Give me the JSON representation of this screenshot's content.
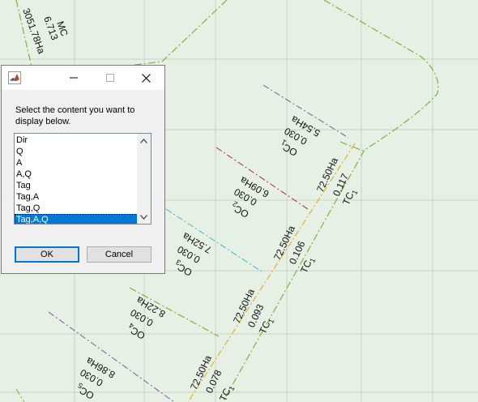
{
  "map": {
    "labels": {
      "top_area": "3051.78Ha",
      "top_dist": "6.713",
      "top_name": "MC",
      "oc1_area": "5.54Ha",
      "oc1_val": "0.030",
      "oc1_name": "OC",
      "oc1_sub": "1",
      "oc2_area": "6.09Ha",
      "oc2_val": "0.030",
      "oc2_name": "OC",
      "oc2_sub": "2",
      "oc3_area": "7.52Ha",
      "oc3_val": "0.030",
      "oc3_name": "OC",
      "oc3_sub": "3",
      "oc4_area": "8.22Ha",
      "oc4_val": "0.030",
      "oc4_name": "OC",
      "oc4_sub": "4",
      "oc5_area": "8.86Ha",
      "oc5_val": "0.030",
      "oc5_name": "OC",
      "oc5_sub": "5",
      "tc1a_area": "72.50Ha",
      "tc1a_val": "0.117",
      "tc1a_name": "TC",
      "tc1a_sub": "1",
      "tc1b_area": "72.50Ha",
      "tc1b_val": "0.106",
      "tc1b_name": "TC",
      "tc1b_sub": "1",
      "tc1c_area": "72.50Ha",
      "tc1c_val": "0.093",
      "tc1c_name": "TC",
      "tc1c_sub": "1",
      "tc1d_area": "72.50Ha",
      "tc1d_val": "0.078",
      "tc1d_name": "TC",
      "tc1d_sub": "1"
    }
  },
  "dialog": {
    "prompt": "Select the content you want to display below.",
    "items": [
      "Dir",
      "Q",
      "A",
      "A,Q",
      "Tag",
      "Tag,A",
      "Tag,Q",
      "Tag,A,Q"
    ],
    "selected_index": 7,
    "ok_label": "OK",
    "cancel_label": "Cancel"
  },
  "colors": {
    "selection": "#0078d7",
    "ok_border": "#0078d7"
  }
}
